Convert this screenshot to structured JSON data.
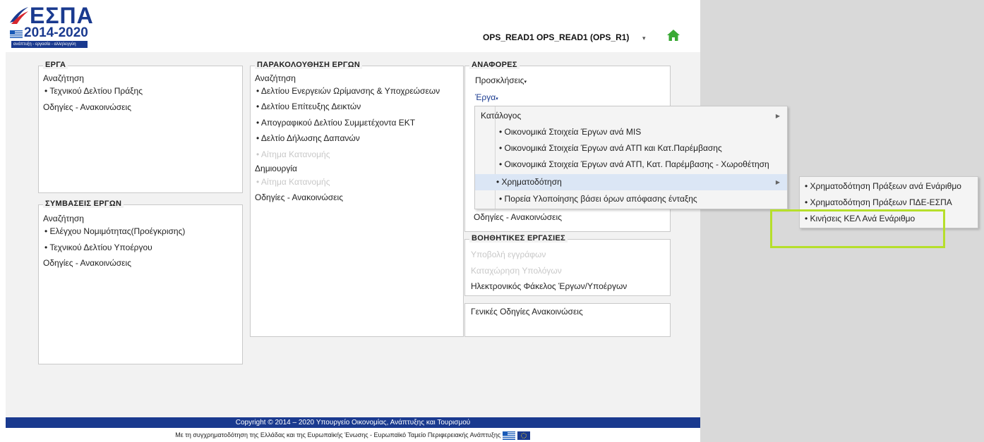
{
  "header": {
    "logo_title": "ΕΣΠΑ",
    "logo_years": "2014-2020",
    "logo_tagline": "ανάπτυξη - εργασία - αλληλεγγύη",
    "user_label": "OPS_READ1 OPS_READ1 (OPS_R1)",
    "user_caret": "▾",
    "colors": {
      "brand": "#1a3a8f",
      "home_icon": "#3aa935"
    }
  },
  "erga": {
    "legend": "ΕΡΓΑ",
    "search_label": "Αναζήτηση",
    "items": [
      "• Τεχνικού Δελτίου Πράξης"
    ],
    "guides": "Οδηγίες - Ανακοινώσεις"
  },
  "symvaseis": {
    "legend": "ΣΥΜΒΑΣΕΙΣ ΕΡΓΩΝ",
    "search_label": "Αναζήτηση",
    "items": [
      "• Ελέγχου Νομιμότητας(Προέγκρισης)",
      "• Τεχνικού Δελτίου Υποέργου"
    ],
    "guides": "Οδηγίες - Ανακοινώσεις"
  },
  "parakolouthisi": {
    "legend": "ΠΑΡΑΚΟΛΟΥΘΗΣΗ ΕΡΓΩΝ",
    "search_label": "Αναζήτηση",
    "items": [
      "• Δελτίου Ενεργειών Ωρίμανσης & Υποχρεώσεων",
      "• Δελτίου Επίτευξης Δεικτών",
      "• Απογραφικού Δελτίου Συμμετέχοντα ΕΚΤ",
      "• Δελτίο Δήλωσης Δαπανών",
      "• Αίτημα Κατανομής"
    ],
    "create_label": "Δημιουργία",
    "create_items": [
      "• Αίτημα Κατανομής"
    ],
    "guides": "Οδηγίες - Ανακοινώσεις"
  },
  "anafores": {
    "legend": "ΑΝΑΦΟΡΕΣ",
    "proskliseis": "Προσκλήσεις",
    "erga": "Έργα",
    "hidden_guides": "Οδηγίες - Ανακοινώσεις"
  },
  "voithitikes": {
    "legend": "ΒΟΗΘΗΤΙΚΕΣ ΕΡΓΑΣΙΕΣ",
    "items_disabled": [
      "Υποβολή εγγράφων",
      "Καταχώρηση Υπολόγων"
    ],
    "efakelos": "Ηλεκτρονικός Φάκελος Έργων/Υποέργων"
  },
  "genikes": {
    "label": "Γενικές Οδηγίες Ανακοινώσεις"
  },
  "menu": {
    "items": [
      {
        "label": "Κατάλογος",
        "submenu": true
      },
      {
        "label": "• Οικονομικά Στοιχεία Έργων ανά MIS",
        "submenu": false
      },
      {
        "label": "• Οικονομικά Στοιχεία Έργων ανά ΑΤΠ και Κατ.Παρέμβασης",
        "submenu": false
      },
      {
        "label": "• Οικονομικά Στοιχεία Έργων ανά ΑΤΠ, Κατ. Παρέμβασης - Χωροθέτηση",
        "submenu": false
      },
      {
        "label": "• Χρηματοδότηση",
        "submenu": true
      },
      {
        "label": "• Πορεία Υλοποίησης βάσει όρων απόφασης ένταξης",
        "submenu": false
      }
    ],
    "submenu_arrow": "▶"
  },
  "submenu": {
    "items": [
      "• Χρηματοδότηση Πράξεων ανά Ενάριθμο",
      "• Χρηματοδότηση Πράξεων ΠΔΕ-ΕΣΠΑ",
      "• Κινήσεις ΚΕΛ Ανά Ενάριθμο"
    ],
    "highlight_color": "#b6df2b"
  },
  "footer": {
    "copyright": "Copyright © 2014 – 2020 Υπουργείο Οικονομίας, Ανάπτυξης και Τουρισμού",
    "cofund": "Με τη συγχρηματοδότηση της Ελλάδας και της Ευρωπαϊκής Ένωσης - Ευρωπαϊκό Ταμείο Περιφερειακής Ανάπτυξης"
  }
}
